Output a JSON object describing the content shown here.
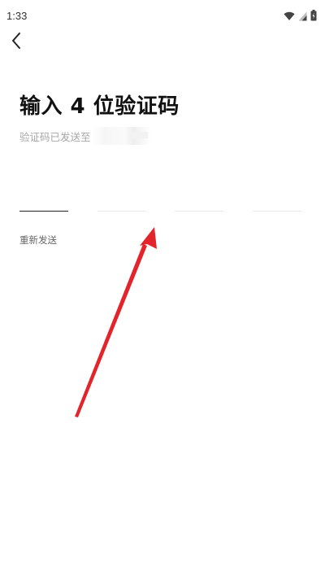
{
  "status_bar": {
    "time": "1:33",
    "icons": [
      "wifi-icon",
      "cellular-signal-icon",
      "battery-icon"
    ]
  },
  "header": {
    "back_icon": "chevron-left-icon"
  },
  "main": {
    "title": "输入 4 位验证码",
    "sent_to_label": "验证码已发送至",
    "code_digit_count": 4,
    "code_digits": [
      "",
      "",
      "",
      ""
    ],
    "active_box_index": 0,
    "resend_label": "重新发送"
  },
  "annotation": {
    "type": "arrow",
    "color": "#e3242b"
  },
  "colors": {
    "background": "#ffffff",
    "title": "#111111",
    "subtext": "#a6a6a6",
    "resend": "#666666",
    "box_line": "#e6e6e6",
    "box_line_active": "#222222"
  }
}
